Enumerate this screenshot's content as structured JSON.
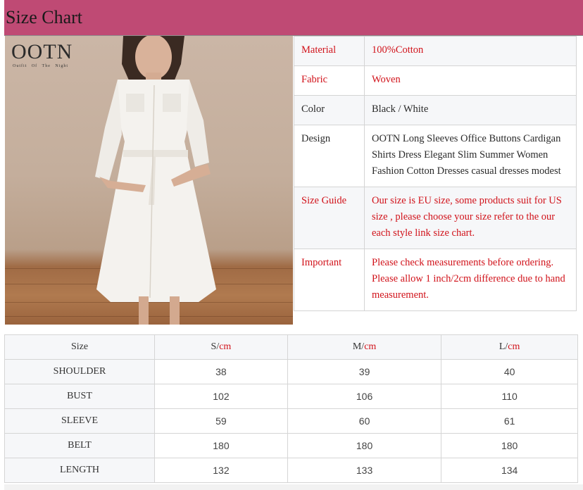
{
  "header": {
    "title": "Size Chart",
    "bg_color": "#bf4a74"
  },
  "logo": {
    "text": "OOTN",
    "subtitle": "Outfit Of The Night"
  },
  "product_info": [
    {
      "label": "Material",
      "value": "100%Cotton",
      "color": "red"
    },
    {
      "label": "Fabric",
      "value": "Woven",
      "color": "red"
    },
    {
      "label": "Color",
      "value": "Black / White",
      "color": "dark"
    },
    {
      "label": "Design",
      "value": "OOTN Long Sleeves Office Buttons Cardigan Shirts Dress Elegant Slim Summer Women Fashion Cotton Dresses casual dresses modest",
      "color": "dark"
    },
    {
      "label": "Size Guide",
      "value": "Our size is EU size, some products suit for US size , please choose your size refer to the our each style link size chart.",
      "color": "red"
    },
    {
      "label": "Important",
      "value": "Please check measurements before ordering. Please allow 1 inch/2cm difference due to hand measurement.",
      "color": "red"
    }
  ],
  "size_table": {
    "corner": "Size",
    "columns": [
      {
        "size": "S/",
        "unit": "cm"
      },
      {
        "size": "M/",
        "unit": "cm"
      },
      {
        "size": "L/",
        "unit": "cm"
      }
    ],
    "rows": [
      {
        "label": "SHOULDER",
        "values": [
          "38",
          "39",
          "40"
        ]
      },
      {
        "label": "BUST",
        "values": [
          "102",
          "106",
          "110"
        ]
      },
      {
        "label": "SLEEVE",
        "values": [
          "59",
          "60",
          "61"
        ]
      },
      {
        "label": "BELT",
        "values": [
          "180",
          "180",
          "180"
        ]
      },
      {
        "label": "LENGTH",
        "values": [
          "132",
          "133",
          "134"
        ]
      }
    ]
  },
  "colors": {
    "accent_red": "#d1121a",
    "header_pink": "#bf4a74"
  }
}
